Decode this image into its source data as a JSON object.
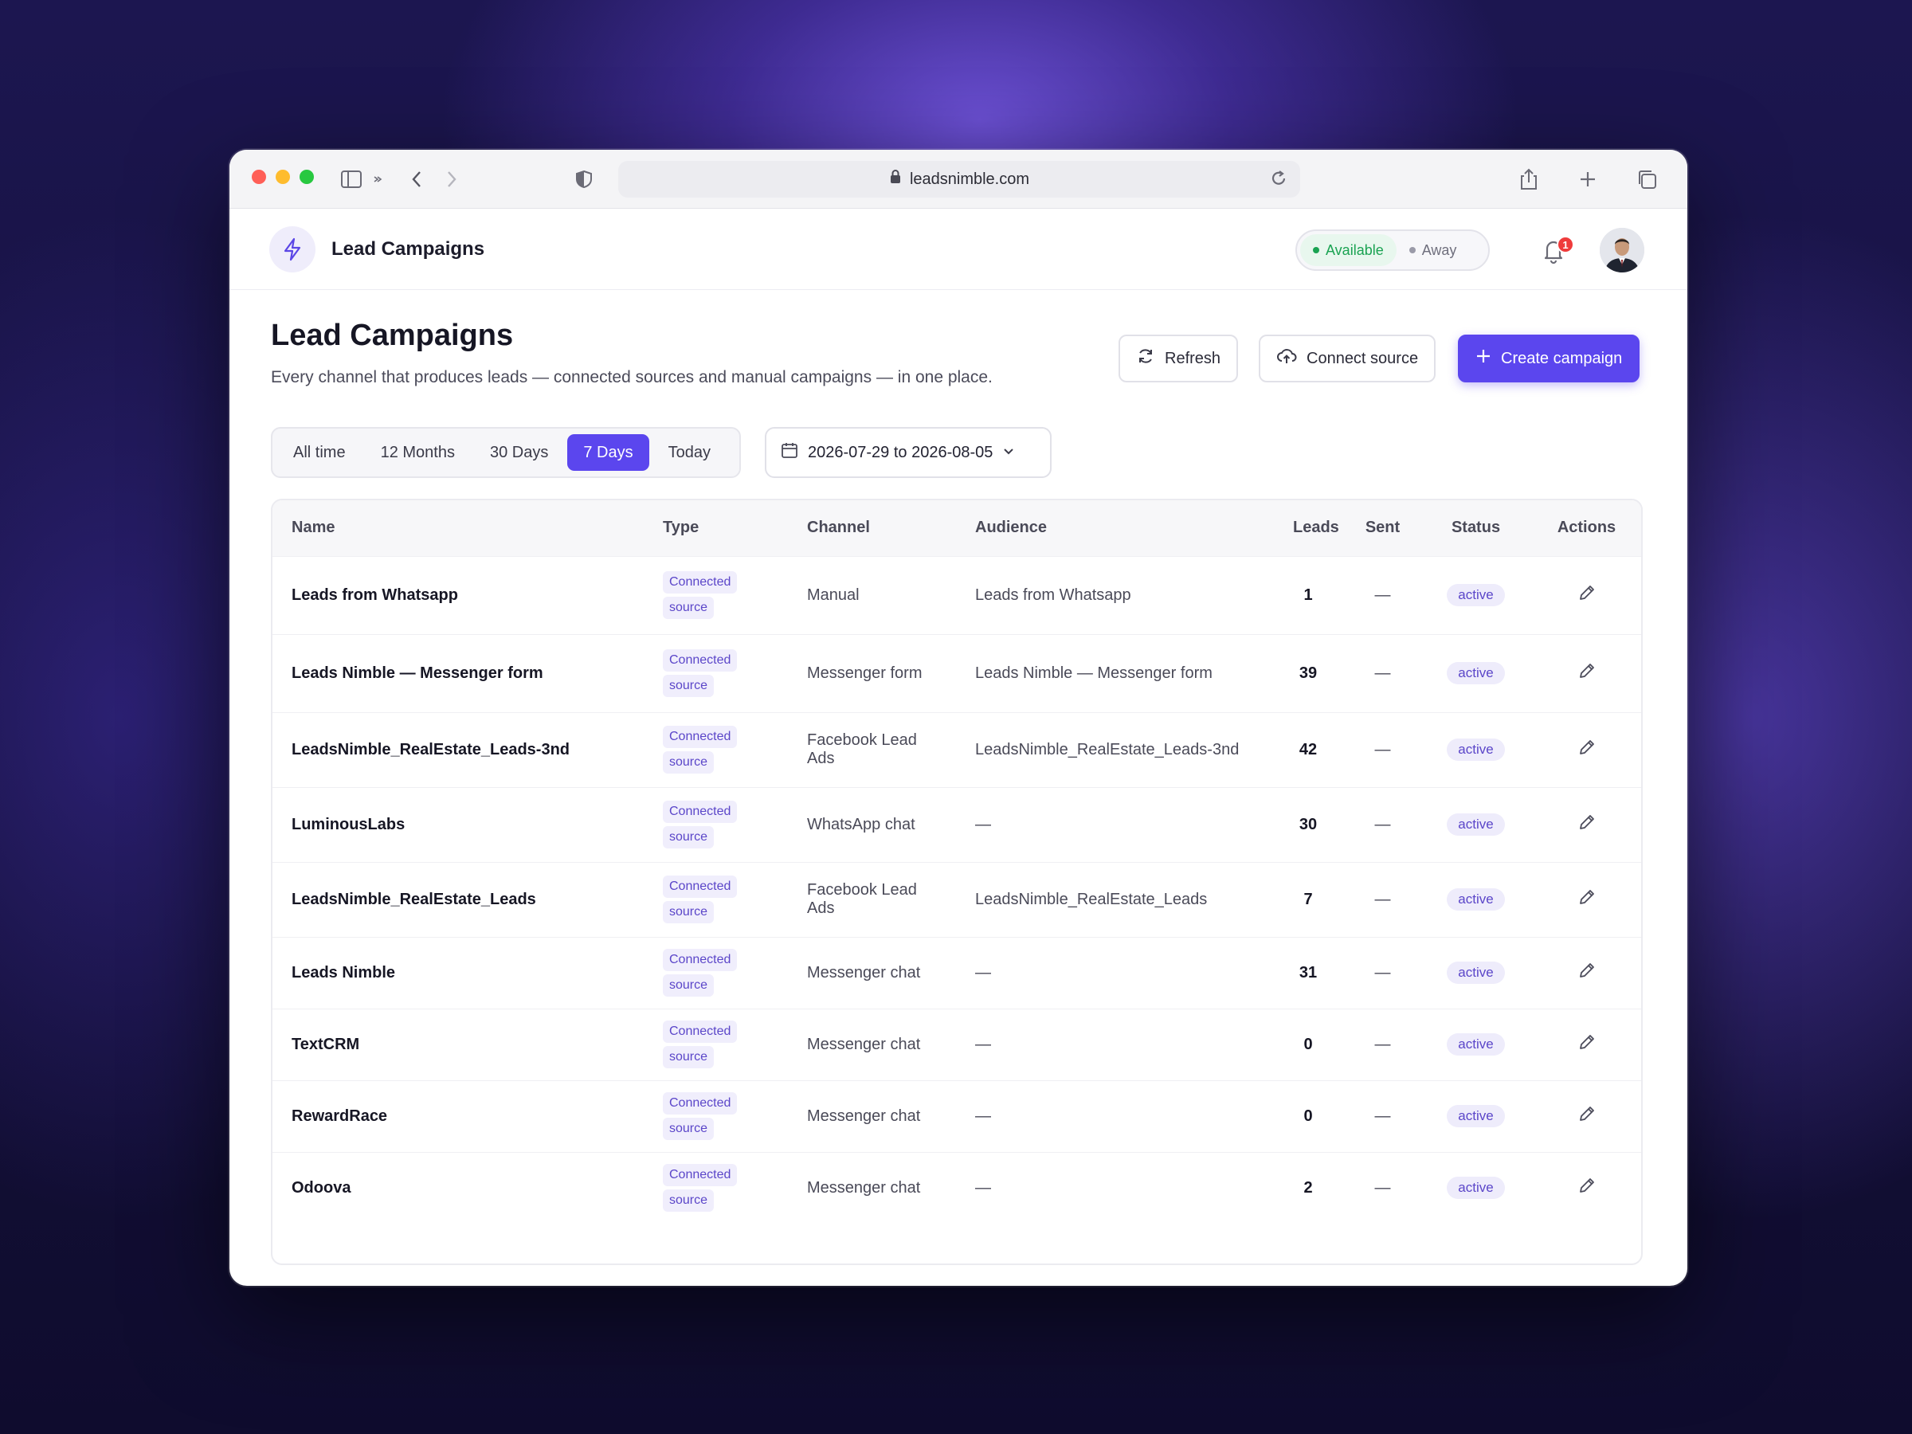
{
  "browser": {
    "url": "leadsnimble.com"
  },
  "app": {
    "header_title": "Lead Campaigns",
    "presence": {
      "available": "Available",
      "away": "Away"
    },
    "notifications_count": "1"
  },
  "page": {
    "title": "Lead Campaigns",
    "subtitle": "Every channel that produces leads — connected sources and manual campaigns — in one place.",
    "buttons": {
      "refresh": "Refresh",
      "connect_source": "Connect source",
      "create_campaign": "Create campaign"
    },
    "ranges": [
      "All time",
      "12 Months",
      "30 Days",
      "7 Days",
      "Today"
    ],
    "active_range": "7 Days",
    "date_range": "2026-07-29 to 2026-08-05"
  },
  "table": {
    "columns": [
      "Name",
      "Type",
      "Channel",
      "Audience",
      "Leads",
      "Sent",
      "Status",
      "Actions"
    ],
    "type_label": [
      "Connected",
      "source"
    ],
    "rows": [
      {
        "name": "Leads from Whatsapp",
        "channel": "Manual",
        "audience": "Leads from Whatsapp",
        "leads": "1",
        "sent": "—",
        "status": "active"
      },
      {
        "name": "Leads Nimble — Messenger form",
        "channel": "Messenger form",
        "audience": "Leads Nimble — Messenger form",
        "leads": "39",
        "sent": "—",
        "status": "active"
      },
      {
        "name": "LeadsNimble_RealEstate_Leads-3nd",
        "channel": "Facebook Lead Ads",
        "audience": "LeadsNimble_RealEstate_Leads-3nd",
        "leads": "42",
        "sent": "—",
        "status": "active"
      },
      {
        "name": "LuminousLabs",
        "channel": "WhatsApp chat",
        "audience": "—",
        "leads": "30",
        "sent": "—",
        "status": "active"
      },
      {
        "name": "LeadsNimble_RealEstate_Leads",
        "channel": "Facebook Lead Ads",
        "audience": "LeadsNimble_RealEstate_Leads",
        "leads": "7",
        "sent": "—",
        "status": "active"
      },
      {
        "name": "Leads Nimble",
        "channel": "Messenger chat",
        "audience": "—",
        "leads": "31",
        "sent": "—",
        "status": "active"
      },
      {
        "name": "TextCRM",
        "channel": "Messenger chat",
        "audience": "—",
        "leads": "0",
        "sent": "—",
        "status": "active"
      },
      {
        "name": "RewardRace",
        "channel": "Messenger chat",
        "audience": "—",
        "leads": "0",
        "sent": "—",
        "status": "active"
      },
      {
        "name": "Odoova",
        "channel": "Messenger chat",
        "audience": "—",
        "leads": "2",
        "sent": "—",
        "status": "active"
      }
    ]
  },
  "colors": {
    "accent": "#5b46ee",
    "available": "#1aa352",
    "badge_bg": "#eeecfb",
    "notification": "#ef3b3b"
  },
  "icons": [
    "sidebar-icon",
    "chevron-left-icon",
    "chevron-right-icon",
    "shield-icon",
    "lock-icon",
    "reload-icon",
    "share-icon",
    "plus-icon",
    "tabs-icon",
    "bolt-icon",
    "bell-icon",
    "refresh-icon",
    "cloud-upload-icon",
    "calendar-icon",
    "chevron-down-icon",
    "pencil-icon"
  ]
}
